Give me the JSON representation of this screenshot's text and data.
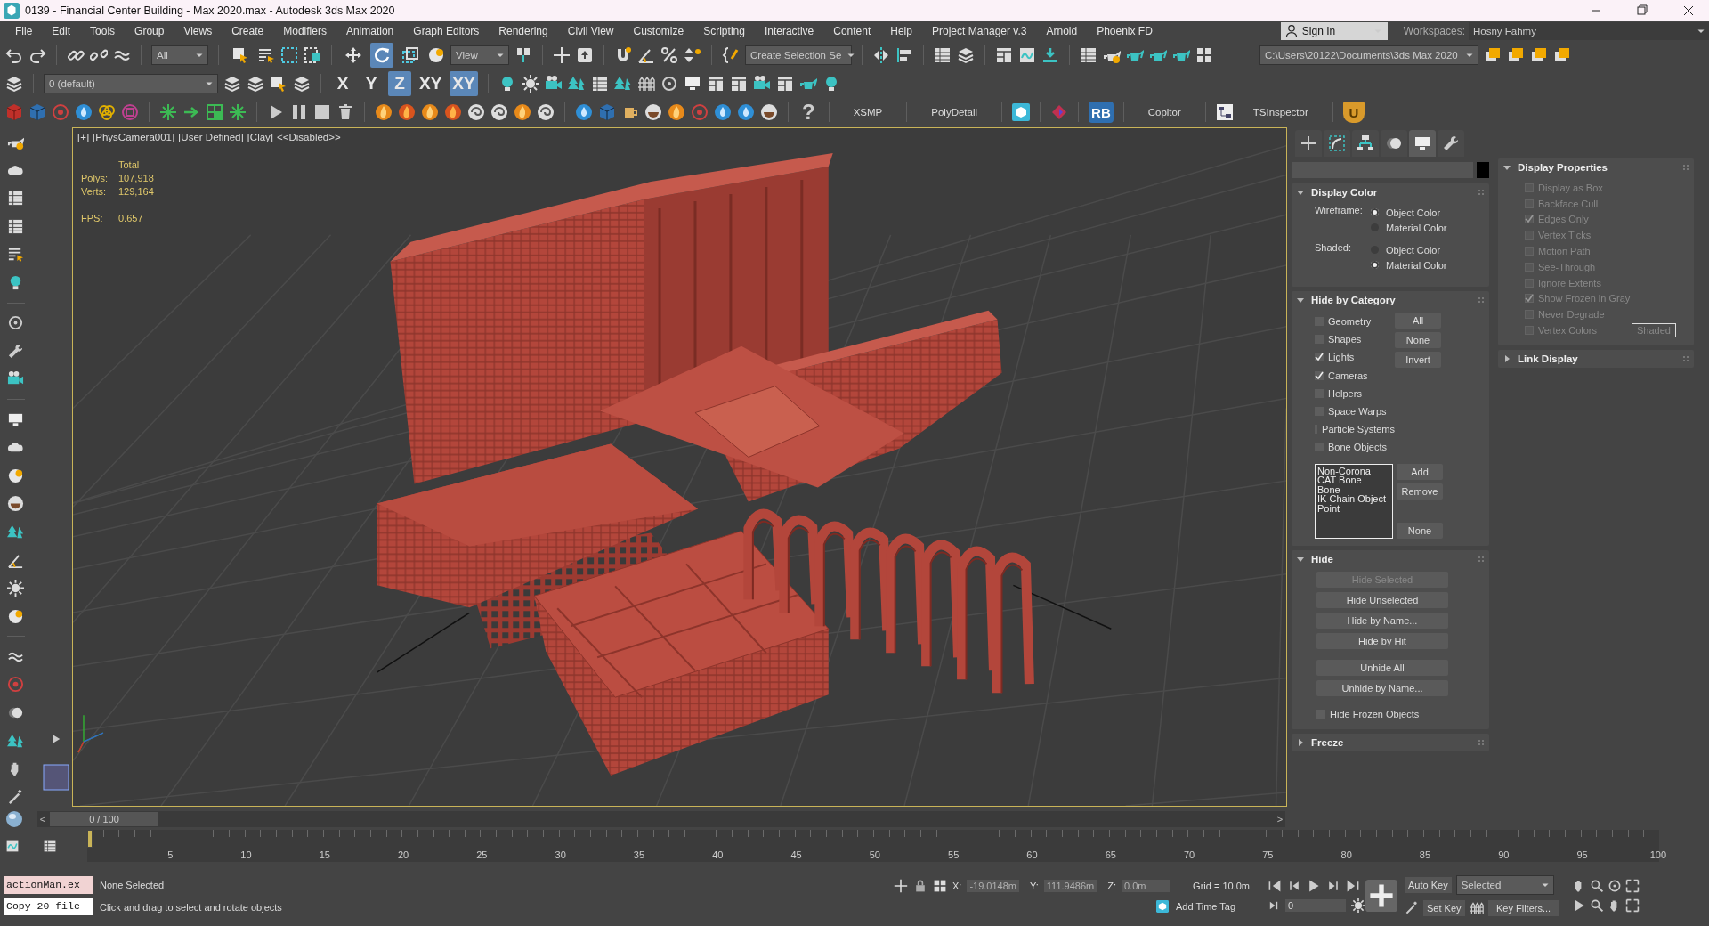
{
  "window": {
    "title": "0139 - Financial Center Building - Max 2020.max - Autodesk 3ds Max 2020"
  },
  "menu": [
    "File",
    "Edit",
    "Tools",
    "Group",
    "Views",
    "Create",
    "Modifiers",
    "Animation",
    "Graph Editors",
    "Rendering",
    "Civil View",
    "Customize",
    "Scripting",
    "Interactive",
    "Content",
    "Help",
    "Project Manager v.3",
    "Arnold",
    "Phoenix FD"
  ],
  "account": {
    "sign_in": "Sign In",
    "workspaces_label": "Workspaces:",
    "workspace": "Hosny Fahmy"
  },
  "main_toolbar": {
    "selection_filter": "All",
    "transform_tools": [
      {
        "kind": "select",
        "selected": false
      },
      {
        "kind": "move",
        "selected": false
      },
      {
        "kind": "rotate",
        "selected": true
      },
      {
        "kind": "scale",
        "selected": false
      }
    ],
    "reference_coordinate": "View",
    "named_selection": "Create Selection Se",
    "project_folder": "C:\\Users\\20122\\Documents\\3ds Max 2020"
  },
  "layer_toolbar": {
    "layer": "0 (default)",
    "axis_constraints": [
      {
        "label": "X",
        "selected": false
      },
      {
        "label": "Y",
        "selected": false
      },
      {
        "label": "Z",
        "selected": true
      },
      {
        "label": "XY",
        "selected": false
      },
      {
        "label": "XY",
        "selected": true
      }
    ]
  },
  "plugin_toolbar": {
    "help": "?",
    "items": [
      {
        "kind": "text",
        "label": "XSMP"
      },
      {
        "kind": "text",
        "label": "PolyDetail"
      },
      {
        "kind": "badge",
        "label": "RB"
      },
      {
        "kind": "text",
        "label": "Copitor"
      },
      {
        "kind": "text",
        "label": "TSInspector"
      },
      {
        "kind": "badge",
        "label": "U"
      }
    ]
  },
  "viewport": {
    "labels": [
      "[+]",
      "[PhysCamera001]",
      "[User Defined]",
      "[Clay]",
      "<<Disabled>>"
    ],
    "stats_header": "Total",
    "stats": [
      {
        "label": "Polys:",
        "value": "107,918"
      },
      {
        "label": "Verts:",
        "value": "129,164"
      }
    ],
    "fps_label": "FPS:",
    "fps": "0.657"
  },
  "command_panel": {
    "tabs": [
      {
        "kind": "create",
        "selected": false
      },
      {
        "kind": "modify",
        "selected": false
      },
      {
        "kind": "hierarchy",
        "selected": false
      },
      {
        "kind": "motion",
        "selected": false
      },
      {
        "kind": "display",
        "selected": true
      },
      {
        "kind": "utilities",
        "selected": false
      }
    ],
    "left_column": [
      {
        "kind": "radio_groups",
        "title": "Display Color",
        "expanded": true,
        "groups": [
          {
            "label": "Wireframe:",
            "options": [
              {
                "label": "Object Color",
                "selected": true
              },
              {
                "label": "Material Color",
                "selected": false
              }
            ]
          },
          {
            "label": "Shaded:",
            "options": [
              {
                "label": "Object Color",
                "selected": false
              },
              {
                "label": "Material Color",
                "selected": true
              }
            ]
          }
        ]
      },
      {
        "kind": "category",
        "title": "Hide by Category",
        "expanded": true,
        "categories": [
          {
            "label": "Geometry",
            "checked": false
          },
          {
            "label": "Shapes",
            "checked": false
          },
          {
            "label": "Lights",
            "checked": true
          },
          {
            "label": "Cameras",
            "checked": true
          },
          {
            "label": "Helpers",
            "checked": false
          },
          {
            "label": "Space Warps",
            "checked": false
          },
          {
            "label": "Particle Systems",
            "checked": false
          },
          {
            "label": "Bone Objects",
            "checked": false
          }
        ],
        "buttons": [
          "All",
          "None",
          "Invert"
        ],
        "list": [
          "Non-Corona",
          "CAT Bone",
          "Bone",
          "IK Chain Object",
          "Point"
        ],
        "list_buttons": [
          "Add",
          "Remove"
        ],
        "list_bottom_button": "None"
      },
      {
        "kind": "buttons",
        "title": "Hide",
        "expanded": true,
        "button_groups": [
          [
            {
              "label": "Hide Selected",
              "disabled": true
            },
            {
              "label": "Hide Unselected",
              "disabled": false
            },
            {
              "label": "Hide by Name...",
              "disabled": false
            },
            {
              "label": "Hide by Hit",
              "disabled": false
            }
          ],
          [
            {
              "label": "Unhide All",
              "disabled": false
            },
            {
              "label": "Unhide by Name...",
              "disabled": false
            }
          ]
        ],
        "checkboxes": [
          {
            "label": "Hide Frozen Objects",
            "checked": false
          }
        ]
      },
      {
        "title": "Freeze",
        "expanded": false
      }
    ],
    "right_column": [
      {
        "kind": "checkboxes",
        "title": "Display Properties",
        "expanded": true,
        "disabled": true,
        "items": [
          {
            "label": "Display as Box",
            "checked": false
          },
          {
            "label": "Backface Cull",
            "checked": false
          },
          {
            "label": "Edges Only",
            "checked": true
          },
          {
            "label": "Vertex Ticks",
            "checked": false
          },
          {
            "label": "Motion Path",
            "checked": false
          },
          {
            "label": "See-Through",
            "checked": false
          },
          {
            "label": "Ignore Extents",
            "checked": false
          },
          {
            "label": "Show Frozen in Gray",
            "checked": true
          },
          {
            "label": "Never Degrade",
            "checked": false
          },
          {
            "label": "Vertex Colors",
            "checked": false,
            "button": "Shaded"
          }
        ]
      },
      {
        "title": "Link Display",
        "expanded": false
      }
    ]
  },
  "timeline": {
    "prev": "<",
    "position": "0 / 100",
    "next": ">",
    "level": 0,
    "ticks": [
      "5",
      "10",
      "15",
      "20",
      "25",
      "30",
      "35",
      "40",
      "45",
      "50",
      "55",
      "60",
      "65",
      "70",
      "75",
      "80",
      "85",
      "90",
      "95",
      "100"
    ]
  },
  "status": {
    "listener": [
      {
        "kind": "macro",
        "text": "actionMan.ex"
      },
      {
        "kind": "output",
        "text": "Copy 20 file"
      }
    ],
    "selection": "None Selected",
    "prompt": "Click and drag to select and rotate objects",
    "coordinates": [
      {
        "label": "X:",
        "value": "-19.0148m"
      },
      {
        "label": "Y:",
        "value": "111.9486m"
      },
      {
        "label": "Z:",
        "value": "0.0m"
      }
    ],
    "grid": "Grid = 10.0m",
    "time_tag": "Add Time Tag",
    "auto_key": "Auto Key",
    "key_mode": "Selected",
    "set_key": "Set Key",
    "key_filters": "Key Filters...",
    "frame": "0"
  }
}
